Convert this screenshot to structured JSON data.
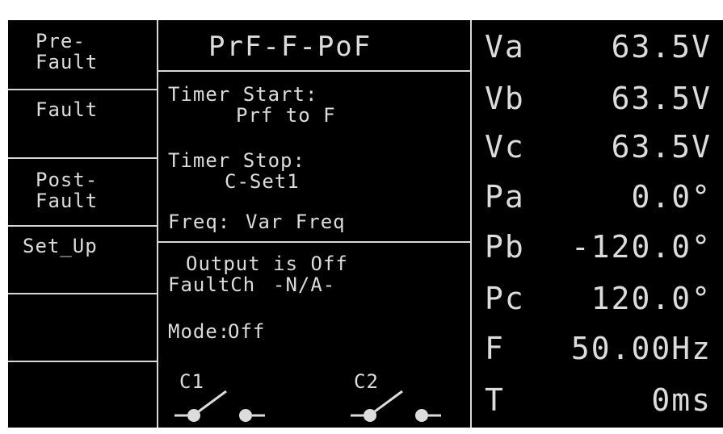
{
  "softkeys": [
    {
      "line1": "Pre-",
      "line2": "Fault"
    },
    {
      "line1": "Fault",
      "line2": ""
    },
    {
      "line1": "Post-",
      "line2": "Fault"
    },
    {
      "line1": "Set_Up",
      "line2": ""
    },
    {
      "line1": "",
      "line2": ""
    },
    {
      "line1": "",
      "line2": ""
    }
  ],
  "middle": {
    "title": "PrF-F-PoF",
    "timer_start_label": "Timer Start:",
    "timer_start_value": "Prf to F",
    "timer_stop_label": "Timer Stop:",
    "timer_stop_value": "C-Set1",
    "freq_label": "Freq:",
    "freq_value": "Var Freq",
    "output_status": "Output is Off",
    "fault_ch_label": "FaultCh",
    "fault_ch_value": "-N/A-",
    "mode_label": "Mode:",
    "mode_value": "Off",
    "c1_label": "C1",
    "c2_label": "C2"
  },
  "readouts": [
    {
      "label": "Va",
      "value": "63.5V"
    },
    {
      "label": "Vb",
      "value": "63.5V"
    },
    {
      "label": "Vc",
      "value": "63.5V"
    },
    {
      "label": "Pa",
      "value": "0.0°"
    },
    {
      "label": "Pb",
      "value": "-120.0°"
    },
    {
      "label": "Pc",
      "value": "120.0°"
    },
    {
      "label": "F",
      "value": "50.00Hz"
    },
    {
      "label": "T",
      "value": "0ms"
    }
  ],
  "colors": {
    "background": "#000000",
    "foreground": "#dcdcdc"
  }
}
